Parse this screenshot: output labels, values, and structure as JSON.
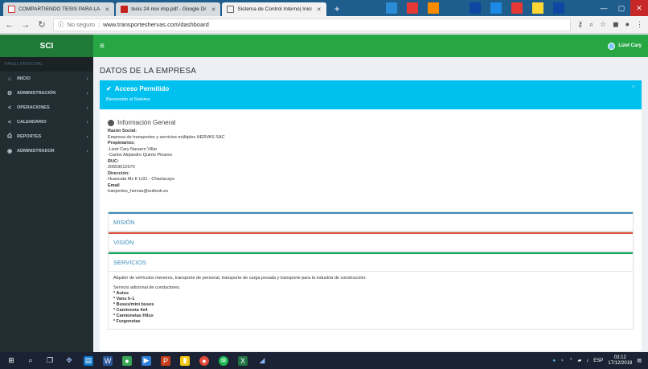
{
  "browser": {
    "tabs": [
      {
        "label": "COMPARTIENDO TESIS PARA LA",
        "favicon_color": "#d93025"
      },
      {
        "label": "tesis 24 nov imp.pdf - Google Dr",
        "favicon_color": "#c5221f"
      },
      {
        "label": "Sistema de Control Interno| Inici",
        "favicon_color": "#ffffff"
      }
    ],
    "new_tab": "+",
    "insecure_label": "No seguro",
    "url": "www.transporteshervas.com/dashboard"
  },
  "app": {
    "logo": "SCI",
    "user_name": "Lizet Cary"
  },
  "sidebar": {
    "header": "PANEL PRINCIPAL",
    "items": [
      {
        "label": "INICIO",
        "icon": "home-icon",
        "glyph": "⌂"
      },
      {
        "label": "ADMINISTRACIÓN",
        "icon": "cogs-icon",
        "glyph": "⚙"
      },
      {
        "label": "OPERACIONES",
        "icon": "share-icon",
        "glyph": "<"
      },
      {
        "label": "CALENDARIO",
        "icon": "share-icon",
        "glyph": "<"
      },
      {
        "label": "REPORTES",
        "icon": "print-icon",
        "glyph": "⎙"
      },
      {
        "label": "ADMINISTRADOR",
        "icon": "user-circle-icon",
        "glyph": "◉"
      }
    ]
  },
  "content": {
    "page_title": "DATOS DE LA EMPRESA",
    "alert": {
      "heading": "Acceso Permitido",
      "message": "Bienvenido al Sistema",
      "color": "#00c0ef"
    },
    "info": {
      "title": "Información General",
      "razon_label": "Razón Social:",
      "razon_value": "Empresa de transportes y servicios múltiples HERVAS SAC",
      "propietarios_label": "Propietarios:",
      "propietario_1": "-Lizet Cary Navarro Villar",
      "propietario_2": "-Carlos Alejandro Quinto Pinares",
      "ruc_label": "RUC:",
      "ruc_value": "20559012670",
      "direccion_label": "Dirección:",
      "direccion_value": "Huascata Mz K Lt31 - Chaclacayo",
      "email_label": "Email",
      "email_value": "tranportes_hervas@outlook.es"
    },
    "sections": {
      "mision": "MISIÓN",
      "vision": "VISIÓN",
      "servicios": "SERVICIOS"
    },
    "servicios_body": {
      "intro": "Alquiler de vehículos menores, transporte de personal, transporte de carga pesada y transporte para la industria de construcción.",
      "adicional": "Servicio adicional de conductores.",
      "items": [
        "* Autos",
        "* Vans h-1",
        "* Buses/mini buses",
        "* Camioneta 4x4",
        "* Camionetas Hilux",
        "* Furgonetas"
      ]
    }
  },
  "taskbar": {
    "language": "ESP",
    "time": "03:12",
    "date": "17/12/2018"
  }
}
